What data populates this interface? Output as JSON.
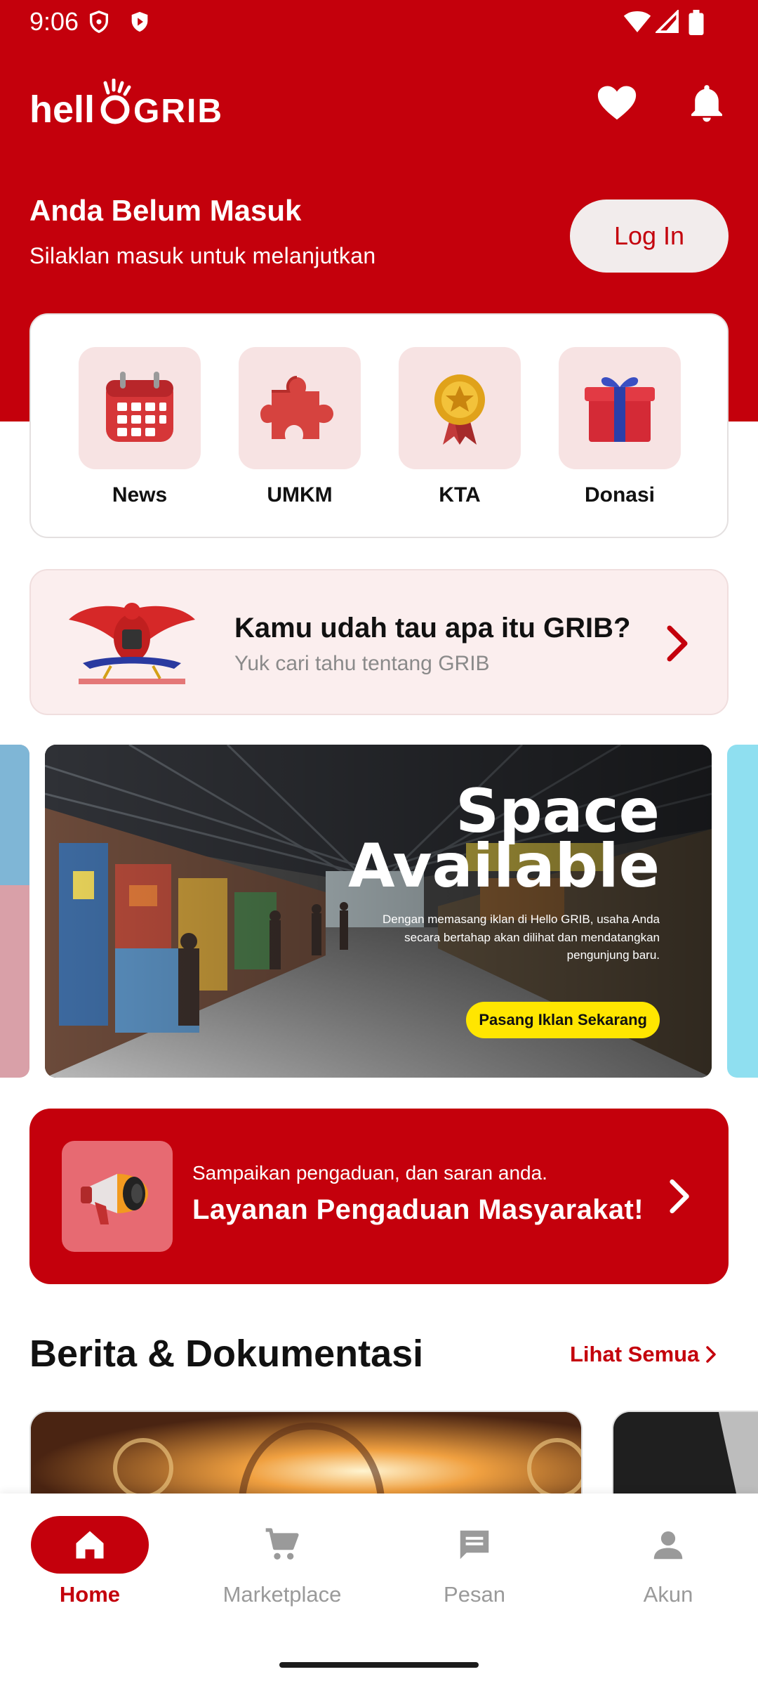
{
  "status_bar": {
    "time": "9:06"
  },
  "header": {
    "logo_text": "hello GRIB"
  },
  "login": {
    "title": "Anda Belum Masuk",
    "subtitle": "Silaklan masuk untuk melanjutkan",
    "button_label": "Log In"
  },
  "menu": {
    "items": [
      {
        "label": "News",
        "icon": "calendar-icon"
      },
      {
        "label": "UMKM",
        "icon": "puzzle-icon"
      },
      {
        "label": "KTA",
        "icon": "medal-icon"
      },
      {
        "label": "Donasi",
        "icon": "gift-icon"
      }
    ]
  },
  "about": {
    "title": "Kamu udah tau apa itu GRIB?",
    "subtitle": "Yuk cari tahu tentang GRIB"
  },
  "carousel": {
    "ad_title_line1": "Space",
    "ad_title_line2": "Available",
    "ad_body": "Dengan memasang iklan di Hello GRIB, usaha Anda secara bertahap akan dilihat dan mendatangkan pengunjung baru.",
    "ad_button": "Pasang Iklan Sekarang"
  },
  "complaint": {
    "subtitle": "Sampaikan pengaduan, dan saran anda.",
    "title": "Layanan Pengaduan Masyarakat!"
  },
  "news": {
    "title": "Berita & Dokumentasi",
    "see_all": "Lihat Semua"
  },
  "bottom_nav": {
    "items": [
      {
        "label": "Home",
        "icon": "home-icon",
        "active": true
      },
      {
        "label": "Marketplace",
        "icon": "cart-icon",
        "active": false
      },
      {
        "label": "Pesan",
        "icon": "message-icon",
        "active": false
      },
      {
        "label": "Akun",
        "icon": "person-icon",
        "active": false
      }
    ]
  },
  "colors": {
    "brand_red": "#c4000c",
    "tile_pink": "#f7e3e3",
    "ad_button_yellow": "#ffe600"
  }
}
